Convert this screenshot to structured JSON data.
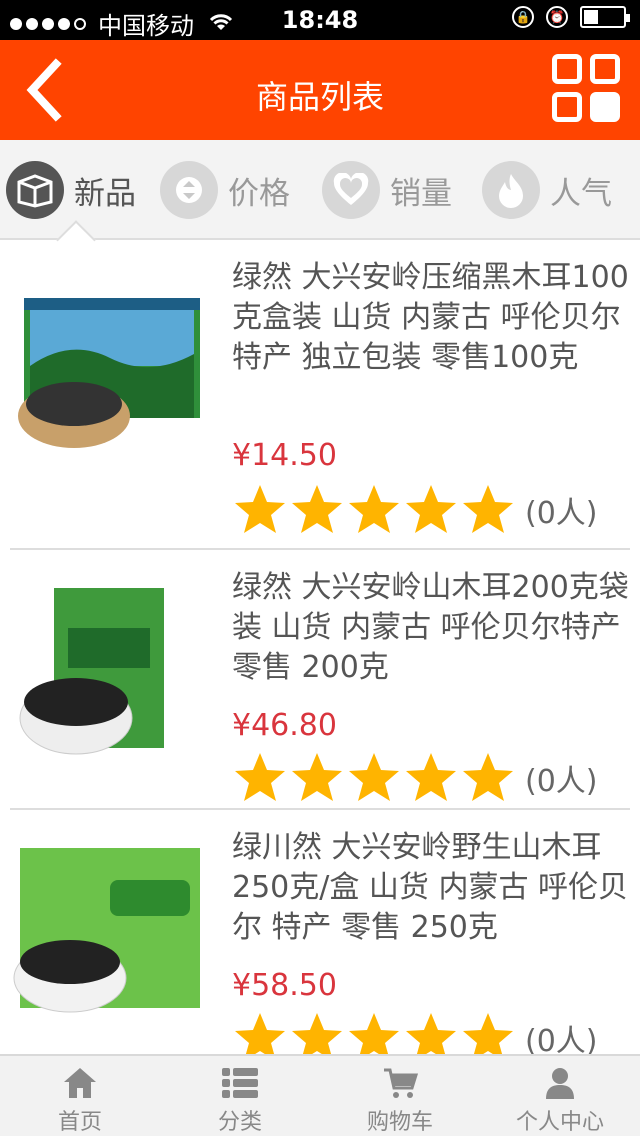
{
  "status": {
    "carrier": "中国移动",
    "time": "18:48"
  },
  "header": {
    "title": "商品列表"
  },
  "sort_tabs": [
    {
      "label": "新品",
      "icon": "box-icon",
      "active": true
    },
    {
      "label": "价格",
      "icon": "sort-arrows-icon",
      "active": false
    },
    {
      "label": "销量",
      "icon": "heart-icon",
      "active": false
    },
    {
      "label": "人气",
      "icon": "flame-icon",
      "active": false
    }
  ],
  "products": [
    {
      "name": "绿然 大兴安岭压缩黑木耳100克盒装 山货 内蒙古 呼伦贝尔 特产 独立包装 零售100克",
      "price": "¥14.50",
      "rating": 5,
      "reviews": "(0人)"
    },
    {
      "name": "绿然 大兴安岭山木耳200克袋装 山货 内蒙古 呼伦贝尔特产 零售 200克",
      "price": "¥46.80",
      "rating": 5,
      "reviews": "(0人)"
    },
    {
      "name": "绿川然 大兴安岭野生山木耳250克/盒 山货 内蒙古 呼伦贝尔 特产 零售 250克",
      "price": "¥58.50",
      "rating": 5,
      "reviews": "(0人)"
    }
  ],
  "bottom_nav": [
    {
      "label": "首页",
      "icon": "home-icon"
    },
    {
      "label": "分类",
      "icon": "list-icon"
    },
    {
      "label": "购物车",
      "icon": "cart-icon"
    },
    {
      "label": "个人中心",
      "icon": "user-icon"
    }
  ],
  "colors": {
    "accent": "#ff4400",
    "price": "#d9353d",
    "star": "#ffb400"
  }
}
